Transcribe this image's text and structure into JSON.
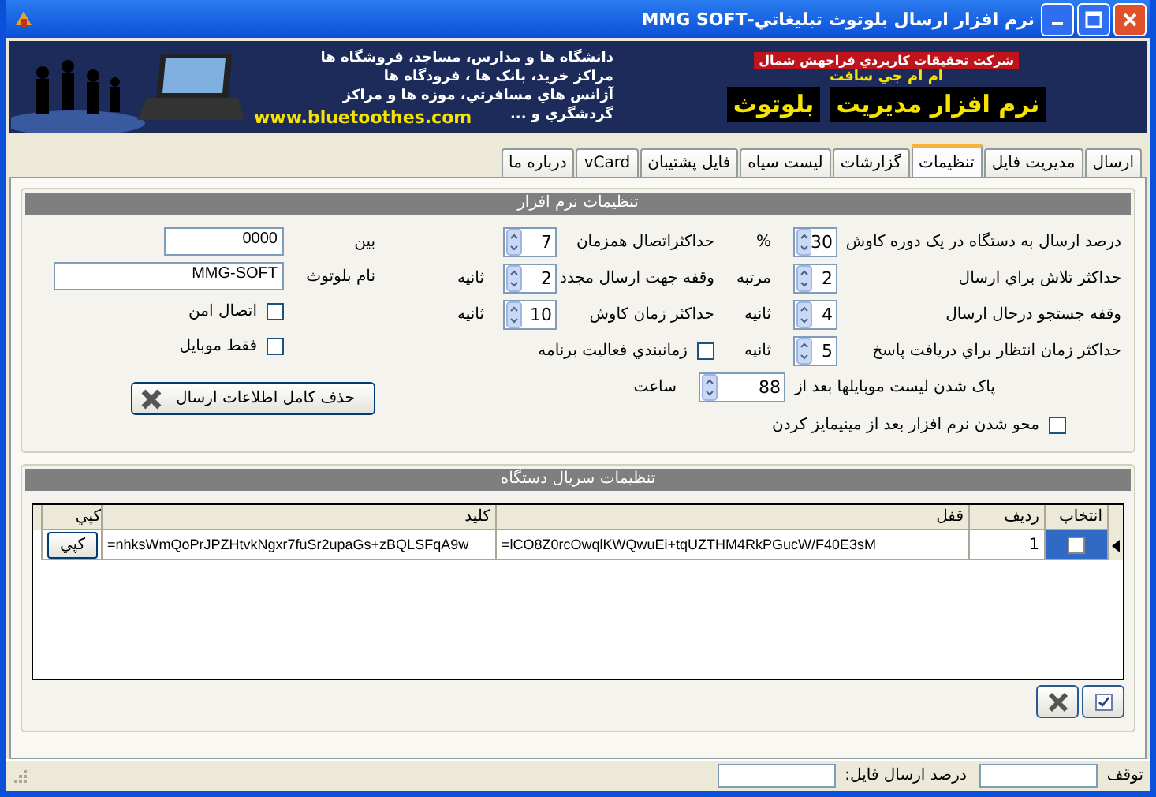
{
  "window": {
    "title": "نرم افزار ارسال بلوتوث تبليغاتي-MMG SOFT"
  },
  "banner": {
    "company": "شرکت تحقيقات کاربردي فراجهش شمال",
    "brand": "ام ام جي سافت",
    "product_1": "نرم افزار مديريت",
    "product_2": "بلوتوث",
    "lines": [
      "دانشگاه ها و مدارس، مساجد، فروشگاه ها",
      "مراکز خريد، بانک ها ، فرودگاه ها",
      "آژانس هاي مسافرتي، موزه ها و مراکز",
      "گردشگري و ..."
    ],
    "url": "www.bluetoothes.com"
  },
  "tabs": [
    {
      "label": "ارسال",
      "selected": false
    },
    {
      "label": "مديريت فايل",
      "selected": false
    },
    {
      "label": "تنظيمات",
      "selected": true
    },
    {
      "label": "گزارشات",
      "selected": false
    },
    {
      "label": "ليست سياه",
      "selected": false
    },
    {
      "label": "فايل پشتيبان",
      "selected": false
    },
    {
      "label": "vCard",
      "selected": false
    },
    {
      "label": "درباره ما",
      "selected": false
    }
  ],
  "general": {
    "title": "تنظيمات نرم افزار",
    "column_1": [
      {
        "kind": "spin",
        "label": "درصد ارسال به دستگاه در يک دوره کاوش",
        "value": "30",
        "unit": "%"
      },
      {
        "kind": "spin",
        "label": "حداکثر تلاش براي ارسال",
        "value": "2",
        "unit": "مرتبه"
      },
      {
        "kind": "spin",
        "label": "وقفه جستجو درحال ارسال",
        "value": "4",
        "unit": "ثانيه"
      },
      {
        "kind": "spin",
        "label": "حداکثر زمان انتظار براي دريافت پاسخ",
        "value": "5",
        "unit": "ثانيه"
      }
    ],
    "column_2": [
      {
        "kind": "spin",
        "label": "حداکثراتصال همزمان",
        "value": "7"
      },
      {
        "kind": "spin",
        "label": "وقفه جهت ارسال مجدد",
        "value": "2",
        "unit": "ثانيه"
      },
      {
        "kind": "spin",
        "label": "حداکثر زمان کاوش",
        "value": "10",
        "unit": "ثانيه"
      },
      {
        "kind": "checkbox",
        "label": "زمانبندي فعاليت برنامه",
        "checked": false
      }
    ],
    "purge": {
      "label": "پاک شدن ليست موبايلها بعد از",
      "value": "88",
      "unit": "ساعت"
    },
    "hide_on_minimize": {
      "label": "محو شدن نرم افزار بعد از مينيمايز کردن",
      "checked": false
    },
    "column_3": [
      {
        "kind": "text",
        "label": "بين",
        "value": "0000"
      },
      {
        "kind": "text",
        "label": "نام بلوتوث",
        "value": "MMG-SOFT"
      },
      {
        "kind": "checkbox",
        "label": "اتصال امن",
        "checked": false
      },
      {
        "kind": "checkbox",
        "label": "فقط موبايل",
        "checked": false
      }
    ],
    "clear_button": "حذف کامل اطلاعات ارسال"
  },
  "serial": {
    "title": "تنظيمات سريال دستگاه",
    "columns": [
      "انتخاب",
      "رديف",
      "قفل",
      "کليد",
      "کپي"
    ],
    "rows": [
      {
        "selected": true,
        "checked": false,
        "index": "1",
        "lock": "=lCO8Z0rcOwqlKWQwuEi+tqUZTHM4RkPGucW/F40E3sM",
        "key": "=nhksWmQoPrJPZHtvkNgxr7fuSr2upaGs+zBQLSFqA9w",
        "copy": "کپي"
      }
    ]
  },
  "status_bar": {
    "stop_label": "توقف",
    "progress_label": "درصد ارسال فايل:"
  }
}
